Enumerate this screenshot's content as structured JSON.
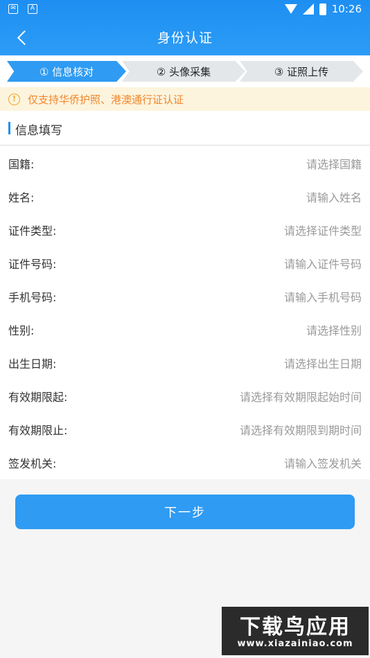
{
  "statusbar": {
    "time": "10:26",
    "left_icons": [
      "mail-icon",
      "A"
    ]
  },
  "navbar": {
    "title": "身份认证"
  },
  "steps": [
    {
      "label": "① 信息核对",
      "active": true
    },
    {
      "label": "② 头像采集",
      "active": false
    },
    {
      "label": "③ 证照上传",
      "active": false
    }
  ],
  "notice": {
    "icon": "!",
    "text": "仅支持华侨护照、港澳通行证认证"
  },
  "section": {
    "title": "信息填写"
  },
  "form": {
    "rows": [
      {
        "label": "国籍:",
        "placeholder": "请选择国籍"
      },
      {
        "label": "姓名:",
        "placeholder": "请输入姓名"
      },
      {
        "label": "证件类型:",
        "placeholder": "请选择证件类型"
      },
      {
        "label": "证件号码:",
        "placeholder": "请输入证件号码"
      },
      {
        "label": "手机号码:",
        "placeholder": "请输入手机号码"
      },
      {
        "label": "性别:",
        "placeholder": "请选择性别"
      },
      {
        "label": "出生日期:",
        "placeholder": "请选择出生日期"
      },
      {
        "label": "有效期限起:",
        "placeholder": "请选择有效期限起始时间"
      },
      {
        "label": "有效期限止:",
        "placeholder": "请选择有效期限到期时间"
      },
      {
        "label": "签发机关:",
        "placeholder": "请输入签发机关"
      }
    ]
  },
  "next_button": {
    "label": "下一步"
  },
  "watermark": {
    "title": "下载鸟应用",
    "url": "www.xiazainiao.com"
  },
  "colors": {
    "primary": "#2f9bf2",
    "notice_text": "#f0862c",
    "notice_bg": "#fdf4dd"
  }
}
